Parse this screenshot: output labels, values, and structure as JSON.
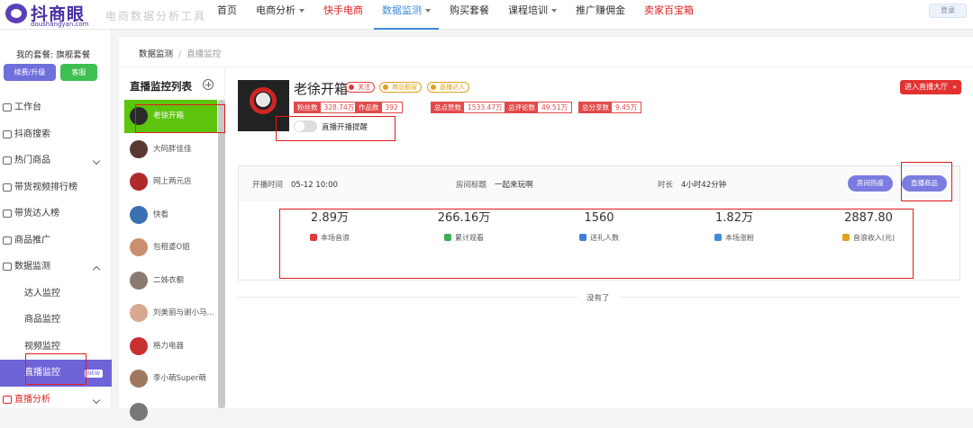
{
  "header": {
    "logo_text": "抖商眼",
    "logo_domain": "doushangyan.com",
    "slogan": "电商数据分析工具",
    "nav": [
      {
        "label": "首页",
        "dropdown": false,
        "style": "normal"
      },
      {
        "label": "电商分析",
        "dropdown": true,
        "style": "normal"
      },
      {
        "label": "快手电商",
        "dropdown": false,
        "style": "red"
      },
      {
        "label": "数据监测",
        "dropdown": true,
        "style": "active"
      },
      {
        "label": "购买套餐",
        "dropdown": false,
        "style": "normal"
      },
      {
        "label": "课程培训",
        "dropdown": true,
        "style": "normal"
      },
      {
        "label": "推广赚佣金",
        "dropdown": false,
        "style": "normal"
      },
      {
        "label": "卖家百宝箱",
        "dropdown": false,
        "style": "red"
      }
    ],
    "user_label": "登录"
  },
  "sidebar": {
    "package_label": "我的套餐: 旗舰套餐",
    "upgrade_button": "续费/升级",
    "service_button": "客服",
    "menu": [
      {
        "label": "工作台",
        "icon": "desk-icon",
        "type": "top"
      },
      {
        "label": "抖商搜索",
        "icon": "search-icon",
        "type": "top"
      },
      {
        "label": "热门商品",
        "icon": "hot-goods-icon",
        "type": "top",
        "arrow": "down"
      },
      {
        "label": "带货视频排行榜",
        "icon": "video-icon",
        "type": "top"
      },
      {
        "label": "带货达人榜",
        "icon": "talent-icon",
        "type": "top"
      },
      {
        "label": "商品推广",
        "icon": "promo-icon",
        "type": "top"
      },
      {
        "label": "数据监测",
        "icon": "chart-icon",
        "type": "top",
        "arrow": "up"
      },
      {
        "label": "达人监控",
        "type": "sub"
      },
      {
        "label": "商品监控",
        "type": "sub"
      },
      {
        "label": "视频监控",
        "type": "sub"
      },
      {
        "label": "直播监控",
        "type": "sub",
        "active": true,
        "badge": "NEW"
      },
      {
        "label": "直播分析",
        "icon": "live-icon",
        "type": "top",
        "arrow": "down",
        "red": true
      }
    ]
  },
  "breadcrumb": {
    "root": "数据监测",
    "separator": "/",
    "current": "直播监控"
  },
  "live_list": {
    "title": "直播监控列表",
    "streamers": [
      {
        "name": "老徐开箱",
        "active": true,
        "avatar_color": "#2a2a2a"
      },
      {
        "name": "大码胖佳佳",
        "avatar_color": "#5a3a30"
      },
      {
        "name": "网上两元店",
        "avatar_color": "#b02a2a"
      },
      {
        "name": "快看",
        "avatar_color": "#3a6fb0"
      },
      {
        "name": "包租婆O姐",
        "avatar_color": "#c9906e"
      },
      {
        "name": "二姊衣橱",
        "avatar_color": "#8a7a70"
      },
      {
        "name": "刘美丽与谢小马...",
        "avatar_color": "#d8a890"
      },
      {
        "name": "格力电器",
        "avatar_color": "#c83030"
      },
      {
        "name": "李小萌Super萌",
        "avatar_color": "#a07860"
      },
      {
        "name": "",
        "avatar_color": "#777777"
      }
    ]
  },
  "profile": {
    "name": "老徐开箱",
    "tags": [
      {
        "label": "关注",
        "color": "#e03a3a"
      },
      {
        "label": "商品橱窗",
        "color": "#e0a020"
      },
      {
        "label": "直播达人",
        "color": "#e0a020"
      }
    ],
    "stats": [
      {
        "key": "粉丝数",
        "value": "328.74万"
      },
      {
        "key": "作品数",
        "value": "392"
      },
      {
        "key": "总点赞数",
        "value": "1533.47万"
      },
      {
        "key": "总评论数",
        "value": "49.51万"
      },
      {
        "key": "总分享数",
        "value": "9.45万"
      }
    ],
    "toggle_label": "直播开播提醒",
    "toggle_on": false,
    "enter_button": "进入直播大厅"
  },
  "session": {
    "start_key": "开播时间",
    "start_value": "05-12 10:00",
    "title_key": "房间标题",
    "title_value": "一起来玩啊",
    "duration_key": "时长",
    "duration_value": "4小时42分钟",
    "room_heat_button": "房间热度",
    "live_goods_button": "直播商品",
    "metrics": [
      {
        "value": "2.89万",
        "label": "本场音浪",
        "icon": "bar-chart-icon",
        "color": "#e03a3a"
      },
      {
        "value": "266.16万",
        "label": "累计观看",
        "icon": "viewer-icon",
        "color": "#3fae52"
      },
      {
        "value": "1560",
        "label": "送礼人数",
        "icon": "gift-icon",
        "color": "#3f7fd9"
      },
      {
        "value": "1.82万",
        "label": "本场涨粉",
        "icon": "fans-icon",
        "color": "#3f8bd9"
      },
      {
        "value": "2887.80",
        "label": "音浪收入(元)",
        "icon": "coin-icon",
        "color": "#e0a020"
      }
    ]
  },
  "end_text": "没有了"
}
